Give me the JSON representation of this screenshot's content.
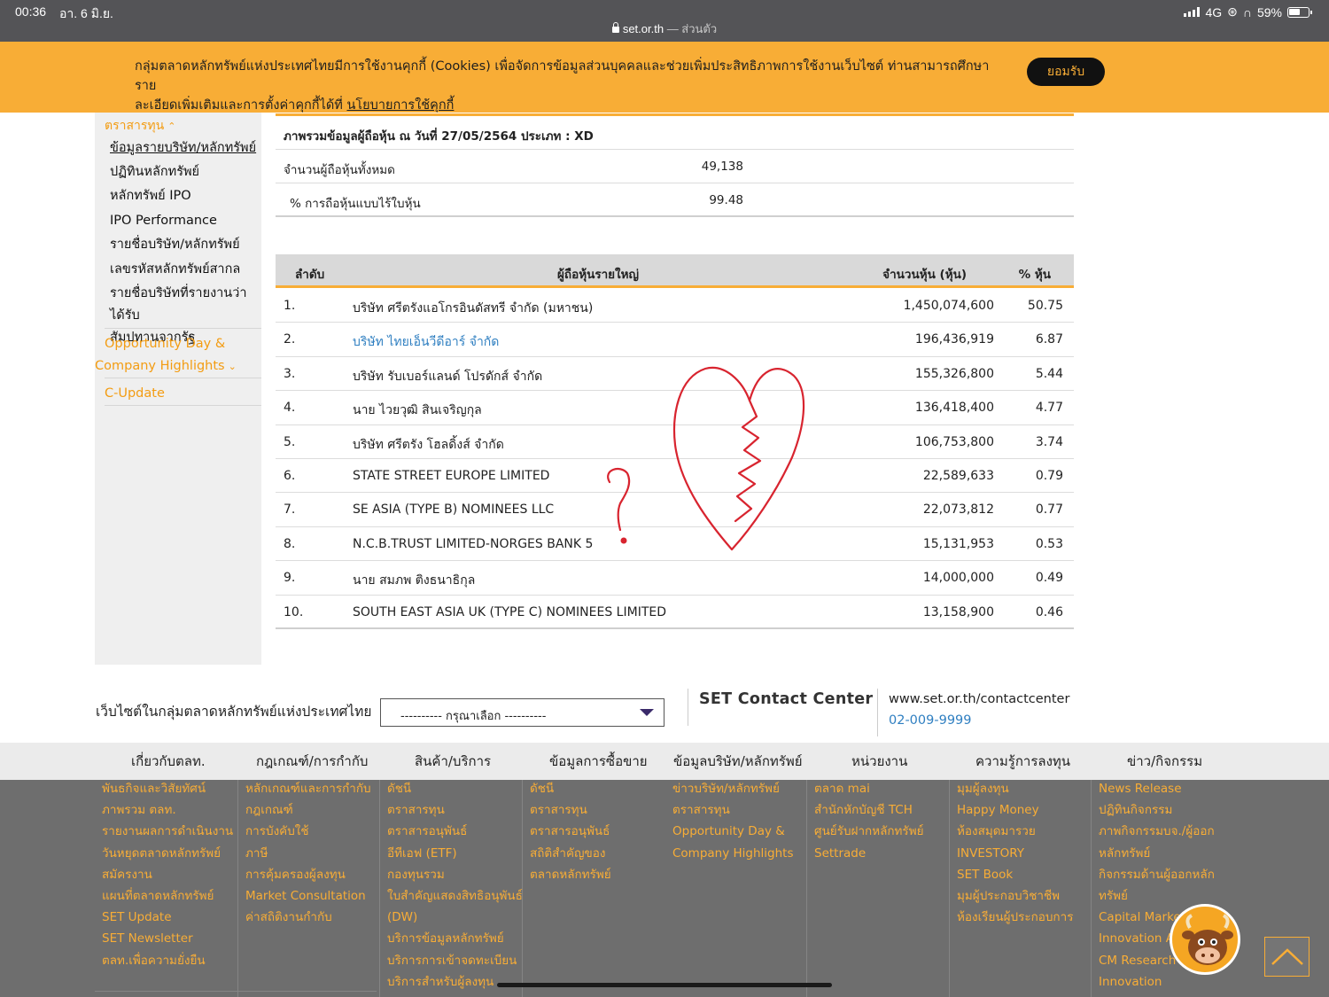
{
  "status_bar": {
    "time": "00:36",
    "date": "อา. 6 มิ.ย.",
    "network": "4G",
    "battery": "59%",
    "url": "set.or.th",
    "mode": "— ส่วนตัว"
  },
  "cookie": {
    "text_1": "กลุ่มตลาดหลักทรัพย์แห่งประเทศไทยมีการใช้งานคุกกี้ (Cookies) เพื่อจัดการข้อมูลส่วนบุคคลและช่วยเพิ่มประสิทธิภาพการใช้งานเว็บไซต์ ท่านสามารถศึกษาราย",
    "text_2": "ละเอียดเพิ่มเติมและการตั้งค่าคุกกี้ได้ที่",
    "link": "นโยบายการใช้คุกกี้",
    "accept": "ยอมรับ"
  },
  "sidebar": {
    "head": "ตราสารทุน",
    "items": [
      "ข้อมูลรายบริษัท/หลักทรัพย์",
      "ปฏิทินหลักทรัพย์",
      "หลักทรัพย์ IPO",
      "IPO Performance",
      "รายชื่อบริษัท/หลักทรัพย์",
      "เลขรหัสหลักทรัพย์สากล",
      "รายชื่อบริษัทที่รายงานว่าได้รับ",
      "สัมปทานจากรัฐ"
    ],
    "opp_1": "Opportunity Day &",
    "opp_2": "Company Highlights",
    "cupdate": "C-Update"
  },
  "summary": {
    "title": "ภาพรวมข้อมูลผู้ถือหุ้น ณ วันที่ 27/05/2564 ประเภท : XD",
    "total_label": "จำนวนผู้ถือหุ้นทั้งหมด",
    "total_value": "49,138",
    "scripless_label": "% การถือหุ้นแบบไร้ใบหุ้น",
    "scripless_value": "99.48"
  },
  "holders": {
    "headers": [
      "ลำดับ",
      "ผู้ถือหุ้นรายใหญ่",
      "จำนวนหุ้น (หุ้น)",
      "% หุ้น"
    ],
    "rows": [
      {
        "rank": "1.",
        "name": "บริษัท ศรีตรังแอโกรอินดัสทรี จำกัด (มหาชน)",
        "shares": "1,450,074,600",
        "pct": "50.75"
      },
      {
        "rank": "2.",
        "name": "บริษัท ไทยเอ็นวีดีอาร์ จำกัด",
        "shares": "196,436,919",
        "pct": "6.87"
      },
      {
        "rank": "3.",
        "name": "บริษัท รับเบอร์แลนด์ โปรดักส์ จำกัด",
        "shares": "155,326,800",
        "pct": "5.44"
      },
      {
        "rank": "4.",
        "name": "นาย ไวยวุฒิ สินเจริญกุล",
        "shares": "136,418,400",
        "pct": "4.77"
      },
      {
        "rank": "5.",
        "name": "บริษัท ศรีตรัง โฮลดิ้งส์ จำกัด",
        "shares": "106,753,800",
        "pct": "3.74"
      },
      {
        "rank": "6.",
        "name": "STATE STREET EUROPE LIMITED",
        "shares": "22,589,633",
        "pct": "0.79"
      },
      {
        "rank": "7.",
        "name": "SE ASIA (TYPE B) NOMINEES LLC",
        "shares": "22,073,812",
        "pct": "0.77"
      },
      {
        "rank": "8.",
        "name": "N.C.B.TRUST LIMITED-NORGES BANK 5",
        "shares": "15,131,953",
        "pct": "0.53"
      },
      {
        "rank": "9.",
        "name": "นาย สมภพ ติงธนาธิกุล",
        "shares": "14,000,000",
        "pct": "0.49"
      },
      {
        "rank": "10.",
        "name": "SOUTH EAST ASIA UK (TYPE C) NOMINEES LIMITED",
        "shares": "13,158,900",
        "pct": "0.46"
      }
    ]
  },
  "sites": {
    "label": "เว็บไซต์ในกลุ่มตลาดหลักทรัพย์แห่งประเทศไทย",
    "select_value": "---------- กรุณาเลือก ----------"
  },
  "contact": {
    "title": "SET Contact Center",
    "web": "www.set.or.th/contactcenter",
    "phone": "02-009-9999"
  },
  "footer_nav": [
    "เกี่ยวกับตลท.",
    "กฎเกณฑ์/การกำกับ",
    "สินค้า/บริการ",
    "ข้อมูลการซื้อขาย",
    "ข้อมูลบริษัท/หลักทรัพย์",
    "หน่วยงาน",
    "ความรู้การลงทุน",
    "ข่าว/กิจกรรม"
  ],
  "footer_cols": [
    [
      "พันธกิจและวิสัยทัศน์",
      "ภาพรวม ตลท.",
      "รายงานผลการดำเนินงาน",
      "วันหยุดตลาดหลักทรัพย์",
      "สมัครงาน",
      "แผนที่ตลาดหลักทรัพย์",
      "SET Update",
      "SET Newsletter",
      "ตลท.เพื่อความยั่งยืน"
    ],
    [
      "หลักเกณฑ์และการกำกับ",
      "กฎเกณฑ์",
      "การบังคับใช้",
      "ภาษี",
      "การคุ้มครองผู้ลงทุน",
      "Market Consultation",
      "ค่าสถิติงานกำกับ"
    ],
    [
      "ดัชนี",
      "ตราสารทุน",
      "ตราสารอนุพันธ์",
      "อีทีเอฟ (ETF)",
      "กองทุนรวม",
      "ใบสำคัญแสดงสิทธิอนุพันธ์",
      "(DW)",
      "บริการข้อมูลหลักทรัพย์",
      "บริการการเข้าจดทะเบียน",
      "บริการสำหรับผู้ลงทุน"
    ],
    [
      "ดัชนี",
      "ตราสารทุน",
      "ตราสารอนุพันธ์",
      "สถิติสำคัญของ",
      "ตลาดหลักทรัพย์"
    ],
    [
      "ข่าวบริษัท/หลักทรัพย์",
      "ตราสารทุน",
      "Opportunity Day &",
      "Company Highlights"
    ],
    [
      "ตลาด mai",
      "สำนักหักบัญชี TCH",
      "ศูนย์รับฝากหลักทรัพย์",
      "Settrade"
    ],
    [
      "มุมผู้ลงทุน",
      "Happy Money",
      "ห้องสมุดมารวย",
      "INVESTORY",
      "SET Book",
      "มุมผู้ประกอบวิชาชีพ",
      "ห้องเรียนผู้ประกอบการ"
    ],
    [
      "News Release",
      "ปฏิทินกิจกรรม",
      "ภาพกิจกรรมบจ./ผู้ออก",
      "หลักทรัพย์",
      "กิจกรรมด้านผู้ออกหลัก",
      "ทรัพย์",
      "Capital Market",
      "Innovation Aw",
      "CM Research",
      "Innovation"
    ]
  ],
  "colors": {
    "accent": "#f8ad36",
    "status_bar": "#545457",
    "footer": "#6e6e6e",
    "link": "#2f7fc1",
    "doodle": "#d8242f"
  },
  "icons": [
    "lock-icon",
    "signal-icon",
    "battery-icon",
    "chevron-up-icon",
    "chevron-down-icon",
    "dropdown-arrow-icon",
    "scroll-top-icon",
    "mascot-icon"
  ]
}
